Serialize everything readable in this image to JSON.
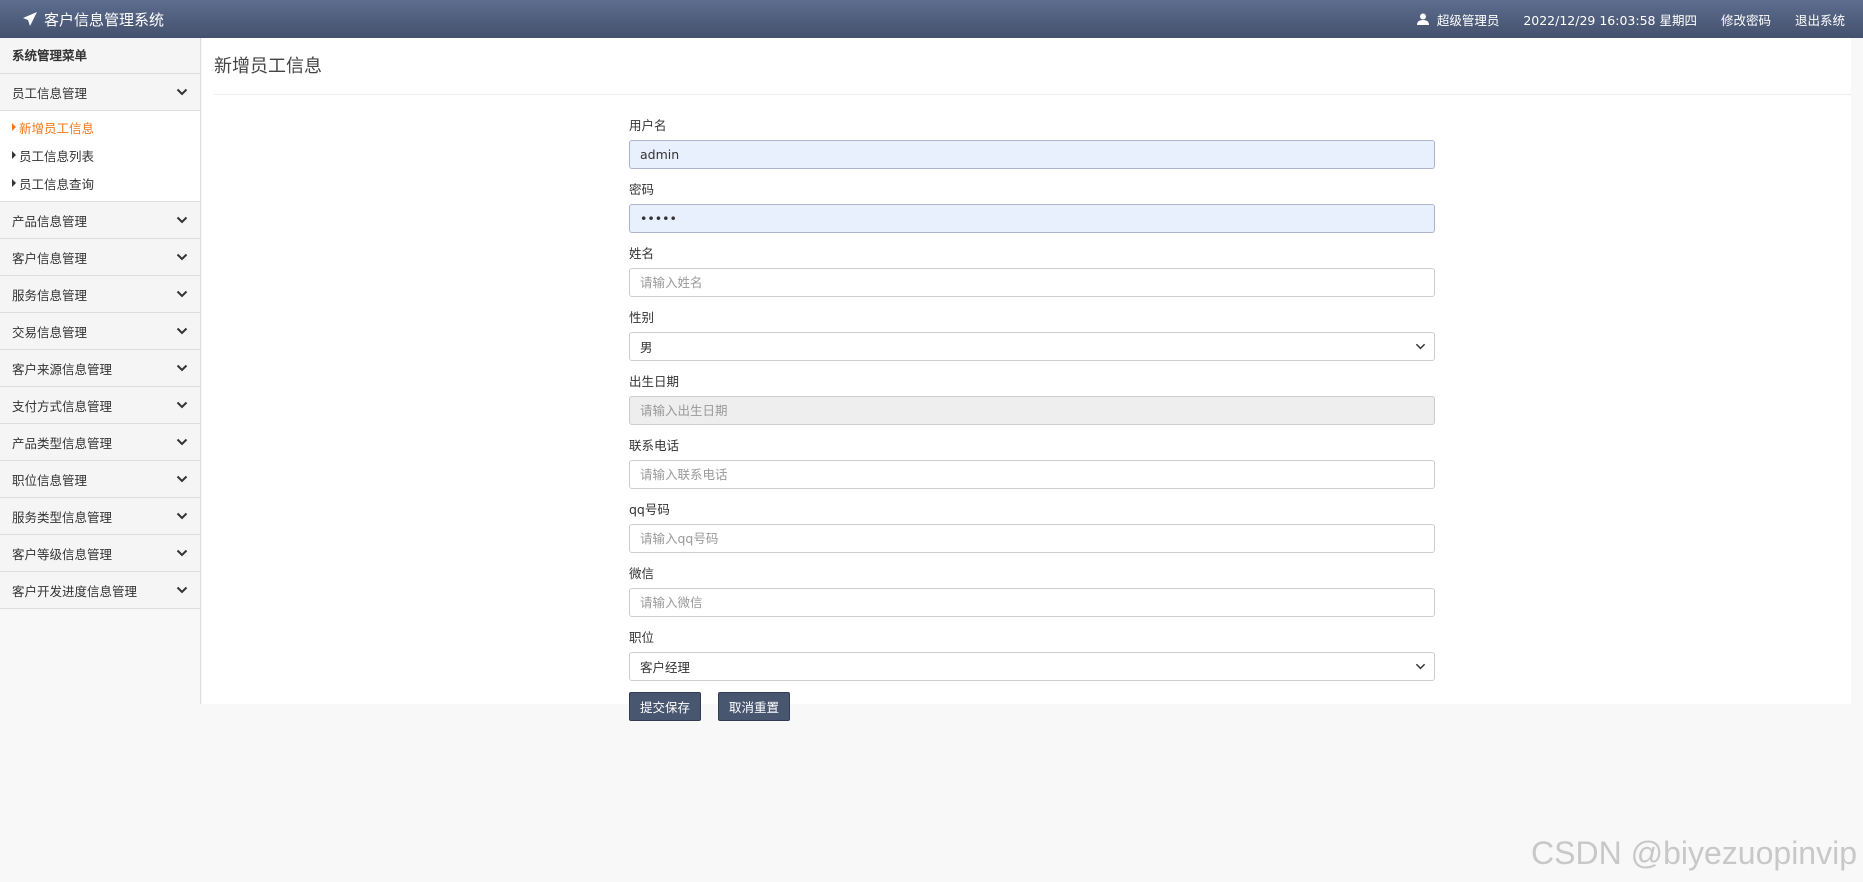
{
  "app": {
    "title": "客户信息管理系统"
  },
  "topnav": {
    "user": "超级管理员",
    "datetime": "2022/12/29 16:03:58 星期四",
    "change_password": "修改密码",
    "logout": "退出系统"
  },
  "sidebar": {
    "title": "系统管理菜单",
    "groups": [
      {
        "label": "员工信息管理",
        "items": [
          "新增员工信息",
          "员工信息列表",
          "员工信息查询"
        ]
      },
      {
        "label": "产品信息管理"
      },
      {
        "label": "客户信息管理"
      },
      {
        "label": "服务信息管理"
      },
      {
        "label": "交易信息管理"
      },
      {
        "label": "客户来源信息管理"
      },
      {
        "label": "支付方式信息管理"
      },
      {
        "label": "产品类型信息管理"
      },
      {
        "label": "职位信息管理"
      },
      {
        "label": "服务类型信息管理"
      },
      {
        "label": "客户等级信息管理"
      },
      {
        "label": "客户开发进度信息管理"
      }
    ]
  },
  "main": {
    "title": "新增员工信息",
    "form": {
      "username": {
        "label": "用户名",
        "value": "admin"
      },
      "password": {
        "label": "密码",
        "value": "•••••"
      },
      "name": {
        "label": "姓名",
        "placeholder": "请输入姓名"
      },
      "gender": {
        "label": "性别",
        "value": "男"
      },
      "birthdate": {
        "label": "出生日期",
        "placeholder": "请输入出生日期"
      },
      "phone": {
        "label": "联系电话",
        "placeholder": "请输入联系电话"
      },
      "qq": {
        "label": "qq号码",
        "placeholder": "请输入qq号码"
      },
      "wechat": {
        "label": "微信",
        "placeholder": "请输入微信"
      },
      "position": {
        "label": "职位",
        "value": "客户经理"
      },
      "submit_label": "提交保存",
      "reset_label": "取消重置"
    }
  },
  "watermark": "CSDN @biyezuopinvip",
  "colors": {
    "topbar": "#4f5d7b",
    "active": "#f0781e",
    "button": "#485670"
  },
  "icons": {
    "brand": "paper-plane-icon",
    "user": "user-icon",
    "chevron": "chevron-down-icon"
  }
}
